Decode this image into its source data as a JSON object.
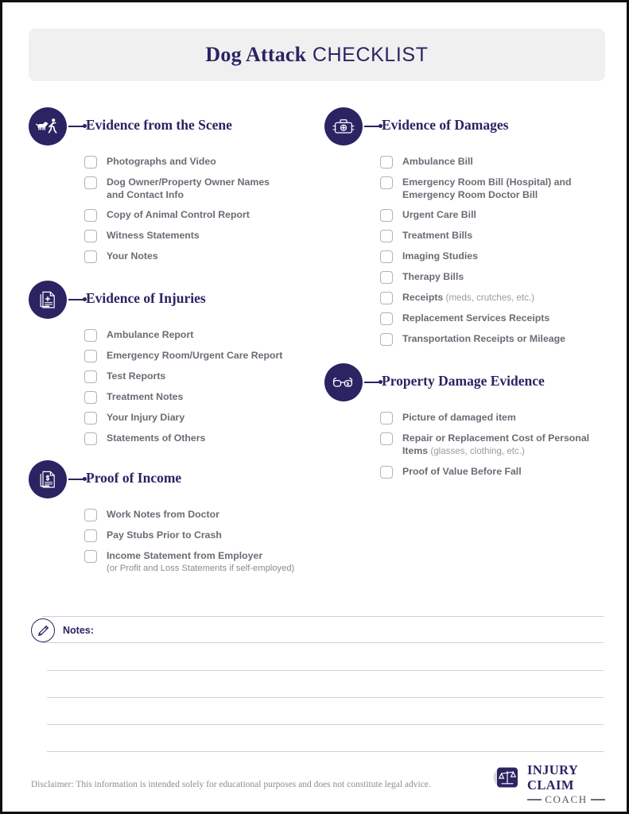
{
  "document": {
    "title_strong": "Dog Attack",
    "title_light": " CHECKLIST"
  },
  "sections": [
    {
      "id": "evidence-from-the-scene",
      "icon": "dog-attack-icon",
      "title": "Evidence from the Scene",
      "items": [
        {
          "label": "Photographs and Video"
        },
        {
          "label": "Dog Owner/Property Owner Names and Contact Info"
        },
        {
          "label": "Copy of Animal Control Report"
        },
        {
          "label": "Witness Statements"
        },
        {
          "label": "Your Notes"
        }
      ]
    },
    {
      "id": "evidence-of-injuries",
      "icon": "medical-document-icon",
      "title": "Evidence of Injuries",
      "items": [
        {
          "label": "Ambulance Report"
        },
        {
          "label": "Emergency Room/Urgent Care Report"
        },
        {
          "label": "Test Reports"
        },
        {
          "label": "Treatment Notes"
        },
        {
          "label": "Your Injury Diary"
        },
        {
          "label": "Statements of Others"
        }
      ]
    },
    {
      "id": "proof-of-income",
      "icon": "income-document-icon",
      "title": "Proof of Income",
      "items": [
        {
          "label": "Work Notes from Doctor"
        },
        {
          "label": "Pay Stubs Prior to Crash"
        },
        {
          "label": "Income Statement from Employer",
          "subnote": "(or Profit and Loss Statements if self-employed)"
        }
      ]
    },
    {
      "id": "evidence-of-damages",
      "icon": "medical-kit-icon",
      "title": "Evidence of Damages",
      "items": [
        {
          "label": "Ambulance Bill"
        },
        {
          "label": "Emergency Room Bill (Hospital) and Emergency Room Doctor Bill"
        },
        {
          "label": "Urgent Care Bill"
        },
        {
          "label": "Treatment Bills"
        },
        {
          "label": "Imaging Studies"
        },
        {
          "label": "Therapy Bills"
        },
        {
          "label": "Receipts",
          "note": " (meds, crutches, etc.)"
        },
        {
          "label": "Replacement Services Receipts"
        },
        {
          "label": "Transportation Receipts or Mileage"
        }
      ]
    },
    {
      "id": "property-damage-evidence",
      "icon": "broken-glasses-icon",
      "title": "Property Damage Evidence",
      "items": [
        {
          "label": "Picture of damaged item"
        },
        {
          "label": "Repair or Replacement Cost of Personal Items",
          "note": " (glasses, clothing, etc.)"
        },
        {
          "label": "Proof of Value Before Fall"
        }
      ]
    }
  ],
  "notes": {
    "icon": "pencil-icon",
    "label": "Notes:",
    "line_count": 4
  },
  "footer": {
    "disclaimer": "Disclaimer: This information is intended solely for educational purposes and does not constitute legal advice.",
    "logo_line1": "INJURY CLAIM",
    "logo_line2": "COACH",
    "logo_icon": "scales-of-justice-icon"
  },
  "colors": {
    "navy": "#2a2463",
    "item_text": "#6b6b75",
    "note_text": "#9a9aa2",
    "checkbox_border": "#b3b3b8",
    "title_bg": "#f0f0f0",
    "rule": "#cfcfd8"
  }
}
